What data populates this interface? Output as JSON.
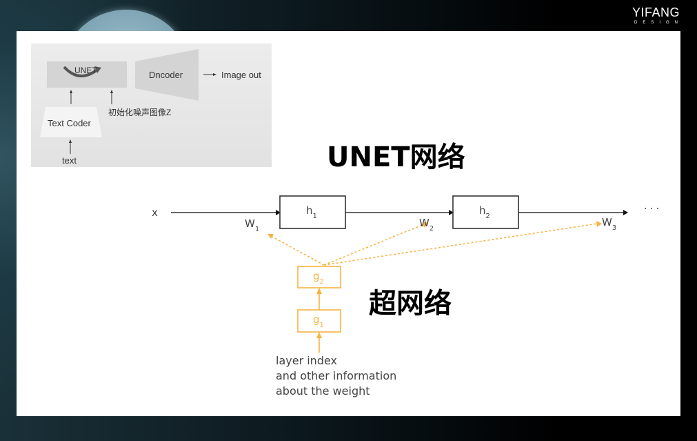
{
  "brand": {
    "name": "YIFANG",
    "sub": "DESIGN"
  },
  "sd_diagram": {
    "unet_label": "UNET",
    "decoder_label": "Dncoder",
    "output_label": "Image out",
    "noise_label": "初始化噪声图像Z",
    "text_coder_label": "Text Coder",
    "input_label": "text"
  },
  "titles": {
    "unet_network": "UNET网络",
    "hypernetwork": "超网络"
  },
  "network": {
    "input": "x",
    "hidden": [
      {
        "name": "h",
        "index": "1"
      },
      {
        "name": "h",
        "index": "2"
      }
    ],
    "weights": [
      {
        "name": "W",
        "index": "1"
      },
      {
        "name": "W",
        "index": "2"
      },
      {
        "name": "W",
        "index": "3"
      }
    ],
    "hyper": [
      {
        "name": "g",
        "index": "1"
      },
      {
        "name": "g",
        "index": "2"
      }
    ],
    "ellipsis": "· · ·",
    "caption_lines": [
      "layer index",
      "and other information",
      "about the weight"
    ]
  },
  "colors": {
    "hyper_accent": "#f5b342",
    "line": "#333333"
  }
}
